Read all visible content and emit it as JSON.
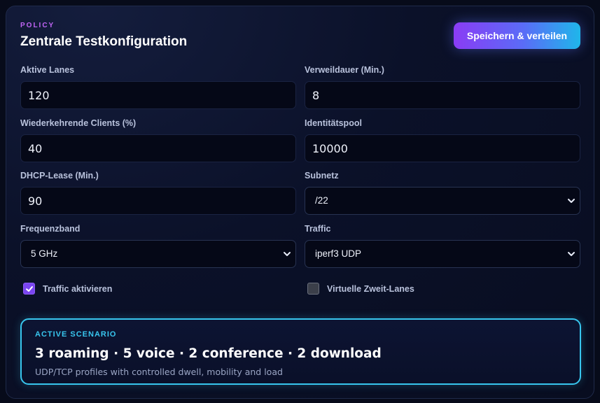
{
  "header": {
    "eyebrow": "POLICY",
    "title": "Zentrale Testkonfiguration",
    "save_label": "Speichern & verteilen"
  },
  "fields": {
    "active_lanes": {
      "label": "Aktive Lanes",
      "value": "120"
    },
    "dwell_time": {
      "label": "Verweildauer (Min.)",
      "value": "8"
    },
    "returning_clients": {
      "label": "Wiederkehrende Clients (%)",
      "value": "40"
    },
    "identity_pool": {
      "label": "Identitätspool",
      "value": "10000"
    },
    "dhcp_lease": {
      "label": "DHCP-Lease (Min.)",
      "value": "90"
    },
    "subnet": {
      "label": "Subnetz",
      "value": "/22"
    },
    "band": {
      "label": "Frequenzband",
      "value": "5 GHz"
    },
    "traffic": {
      "label": "Traffic",
      "value": "iperf3 UDP"
    }
  },
  "checkboxes": {
    "traffic_enabled": {
      "label": "Traffic aktivieren",
      "checked": true
    },
    "virtual_lanes": {
      "label": "Virtuelle Zweit-Lanes",
      "checked": false
    }
  },
  "scenario": {
    "eyebrow": "ACTIVE SCENARIO",
    "title": "3 roaming · 5 voice · 2 conference · 2 download",
    "subtitle": "UDP/TCP profiles with controlled dwell, mobility and load"
  },
  "colors": {
    "accent_purple": "#8a3cf5",
    "accent_cyan": "#38c6ee",
    "background": "#070b1a"
  }
}
